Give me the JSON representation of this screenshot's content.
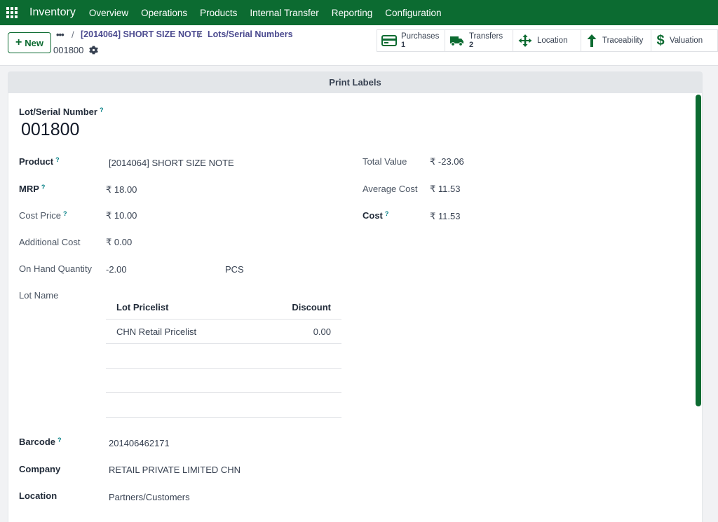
{
  "navbar": {
    "app_name": "Inventory",
    "menu": [
      "Overview",
      "Operations",
      "Products",
      "Internal Transfer",
      "Reporting",
      "Configuration"
    ]
  },
  "control_panel": {
    "new_label": "New",
    "breadcrumb": {
      "dots": "•••",
      "items": [
        "[2014064] SHORT SIZE NOTE",
        "Lots/Serial Numbers"
      ],
      "current": "001800"
    },
    "smart_buttons": [
      {
        "icon": "credit-card-icon",
        "label": "Purchases",
        "count": "1"
      },
      {
        "icon": "truck-icon",
        "label": "Transfers",
        "count": "2"
      },
      {
        "icon": "arrows-move-icon",
        "label": "Location",
        "count": ""
      },
      {
        "icon": "arrow-up-icon",
        "label": "Traceability",
        "count": ""
      },
      {
        "icon": "dollar-icon",
        "label": "Valuation",
        "count": ""
      }
    ]
  },
  "form": {
    "print_labels": "Print Labels",
    "lot_label": "Lot/Serial Number",
    "lot_value": "001800",
    "help_mark": "?",
    "left": {
      "product_label": "Product",
      "product_value": "[2014064] SHORT SIZE NOTE",
      "mrp_label": "MRP",
      "mrp_value": "₹ 18.00",
      "cost_price_label": "Cost Price",
      "cost_price_value": "₹ 10.00",
      "additional_cost_label": "Additional Cost",
      "additional_cost_value": "₹ 0.00",
      "on_hand_label": "On Hand Quantity",
      "on_hand_value": "-2.00",
      "on_hand_uom": "PCS",
      "lot_name_label": "Lot Name",
      "barcode_label": "Barcode",
      "barcode_value": "201406462171",
      "company_label": "Company",
      "company_value": "RETAIL PRIVATE LIMITED CHN",
      "location_label": "Location",
      "location_value": "Partners/Customers"
    },
    "right": {
      "total_value_label": "Total Value",
      "total_value": "₹ -23.06",
      "average_cost_label": "Average Cost",
      "average_cost": "₹ 11.53",
      "cost_label": "Cost",
      "cost_value": "₹ 11.53"
    },
    "pricelist_table": {
      "headers": [
        "Lot Pricelist",
        "Discount"
      ],
      "rows": [
        {
          "name": "CHN Retail Pricelist",
          "discount": "0.00"
        }
      ]
    }
  },
  "colors": {
    "brand": "#0c6b31",
    "link": "#4b4a8f",
    "help": "#017e84"
  }
}
